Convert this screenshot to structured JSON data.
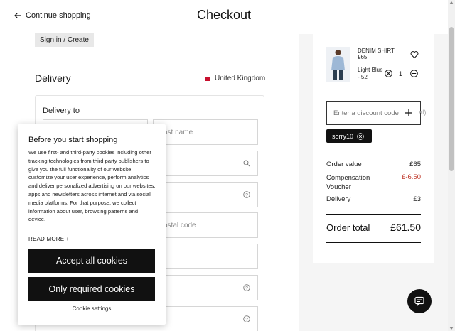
{
  "header": {
    "back_label": "Continue shopping",
    "title": "Checkout"
  },
  "account": {
    "signin_label": "Sign in / Create"
  },
  "delivery": {
    "heading": "Delivery",
    "country": "United Kingdom",
    "deliver_to_label": "Delivery to",
    "fields": {
      "last_name_placeholder": "ast name",
      "postal_code_placeholder": "ostal code"
    }
  },
  "cart": {
    "item": {
      "name": "DENIM SHIRT",
      "price": "£65",
      "color_size": "Light Blue - 52",
      "quantity": "1"
    },
    "discount": {
      "placeholder": "Enter a discount code",
      "overflow_text": "al)",
      "applied_code": "sorry10"
    },
    "summary": {
      "order_value_label": "Order value",
      "order_value": "£65",
      "voucher_label": "Compensation Voucher",
      "voucher_value": "£-6.50",
      "delivery_label": "Delivery",
      "delivery_value": "£3",
      "total_label": "Order total",
      "total_value": "£61.50"
    }
  },
  "cookies": {
    "title": "Before you start shopping",
    "body": "We use first- and third-party cookies including other tracking technologies from third party publishers to give you the full functionality of our website, customize your user experience, perform analytics and deliver personalized advertising on our websites, apps and newsletters across internet and via social media platforms. For that purpose, we collect information about user, browsing patterns and device.",
    "read_more": "READ MORE +",
    "accept_all": "Accept all cookies",
    "only_required": "Only required cookies",
    "settings": "Cookie settings"
  },
  "colors": {
    "text": "#222222",
    "button_dark": "#111111",
    "discount_red": "#c0392b",
    "panel_grey": "#f5f5f5"
  }
}
